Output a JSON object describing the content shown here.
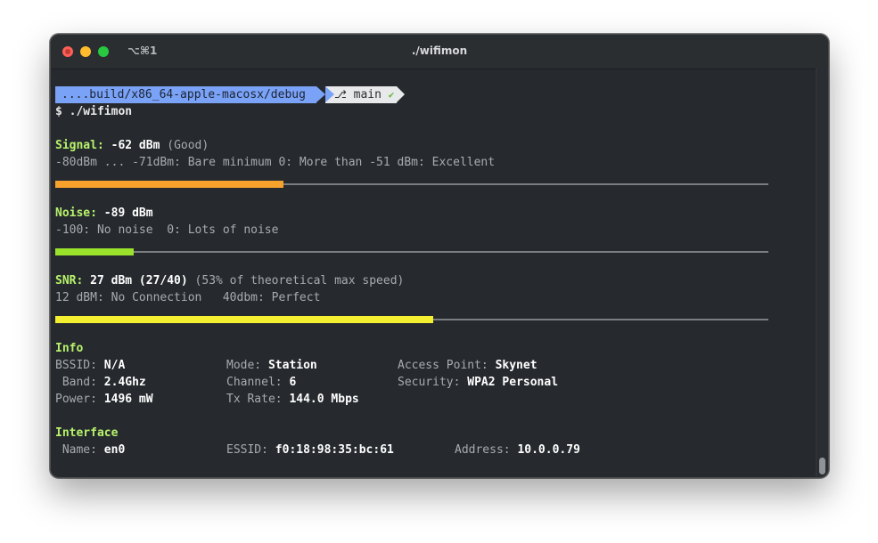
{
  "window": {
    "shortcut": "⌥⌘1",
    "title": "./wifimon"
  },
  "prompt": {
    "path": "....build/x86_64-apple-macosx/debug",
    "branch": "main",
    "branch_icon": "git-branch-icon",
    "status_icon": "check-icon",
    "command": "$ ./wifimon"
  },
  "signal": {
    "label": "Signal:",
    "value": "-62 dBm",
    "quality": "(Good)",
    "legend": "-80dBm ... -71dBm: Bare minimum 0: More than -51 dBm: Excellent",
    "level": 0.32,
    "color": "#f6a22c"
  },
  "noise": {
    "label": "Noise:",
    "value": "-89 dBm",
    "legend": "-100: No noise  0: Lots of noise",
    "level": 0.11,
    "color": "#9be22d"
  },
  "snr": {
    "label": "SNR:",
    "value": "27 dBm (27/40)",
    "note": "(53% of theoretical max speed)",
    "legend": "12 dBM: No Connection   40dbm: Perfect",
    "level": 0.53,
    "color": "#f4ef31"
  },
  "info": {
    "heading": "Info",
    "bssid_label": "BSSID:",
    "bssid": "N/A",
    "mode_label": "Mode:",
    "mode": "Station",
    "ap_label": "Access Point:",
    "ap": "Skynet",
    "band_label": " Band:",
    "band": "2.4Ghz",
    "channel_label": "Channel:",
    "channel": "6",
    "security_label": "Security:",
    "security": "WPA2 Personal",
    "power_label": "Power:",
    "power": "1496 mW",
    "txrate_label": "Tx Rate:",
    "txrate": "144.0 Mbps"
  },
  "interface": {
    "heading": "Interface",
    "name_label": " Name:",
    "name": "en0",
    "essid_label": "ESSID:",
    "essid": "f0:18:98:35:bc:61",
    "address_label": "Address:",
    "address": "10.0.0.79"
  }
}
